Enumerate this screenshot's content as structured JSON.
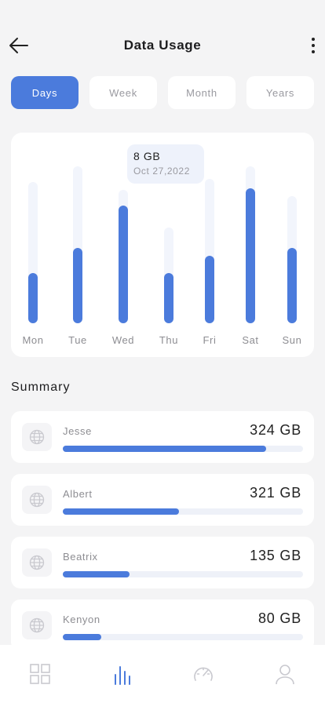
{
  "header": {
    "title": "Data Usage",
    "back_icon": "arrow-left-icon",
    "more_icon": "more-vertical-icon"
  },
  "tabs": [
    {
      "label": "Days",
      "active": true
    },
    {
      "label": "Week",
      "active": false
    },
    {
      "label": "Month",
      "active": false
    },
    {
      "label": "Years",
      "active": false
    }
  ],
  "tooltip": {
    "value": "8 GB",
    "date": "Oct 27,2022"
  },
  "chart_data": {
    "type": "bar",
    "categories": [
      "Mon",
      "Tue",
      "Wed",
      "Thu",
      "Fri",
      "Sat",
      "Sun"
    ],
    "values": [
      0.32,
      0.48,
      0.75,
      0.32,
      0.43,
      0.86,
      0.48
    ],
    "track_values": [
      0.9,
      1.0,
      0.85,
      0.61,
      0.92,
      1.0,
      0.81
    ],
    "ylim": [
      0,
      1
    ],
    "colors": {
      "bar": "#4b7bdc",
      "track": "#f2f5fc",
      "label": "#8d8d92"
    }
  },
  "summary": {
    "title": "Summary",
    "items": [
      {
        "name": "Jesse",
        "amount": "324 GB",
        "progress": 0.846,
        "icon": "globe-icon"
      },
      {
        "name": "Albert",
        "amount": "321 GB",
        "progress": 0.484,
        "icon": "globe-icon"
      },
      {
        "name": "Beatrix",
        "amount": "135 GB",
        "progress": 0.278,
        "icon": "globe-icon"
      },
      {
        "name": "Kenyon",
        "amount": "80 GB",
        "progress": 0.16,
        "icon": "globe-icon"
      }
    ]
  },
  "bottom_nav": [
    {
      "icon": "grid-icon",
      "active": false
    },
    {
      "icon": "bar-chart-icon",
      "active": true
    },
    {
      "icon": "speedometer-icon",
      "active": false
    },
    {
      "icon": "user-icon",
      "active": false
    }
  ],
  "colors": {
    "accent": "#4b7bdc",
    "background": "#f4f4f5",
    "inactive_icon": "#c9c9cf"
  }
}
